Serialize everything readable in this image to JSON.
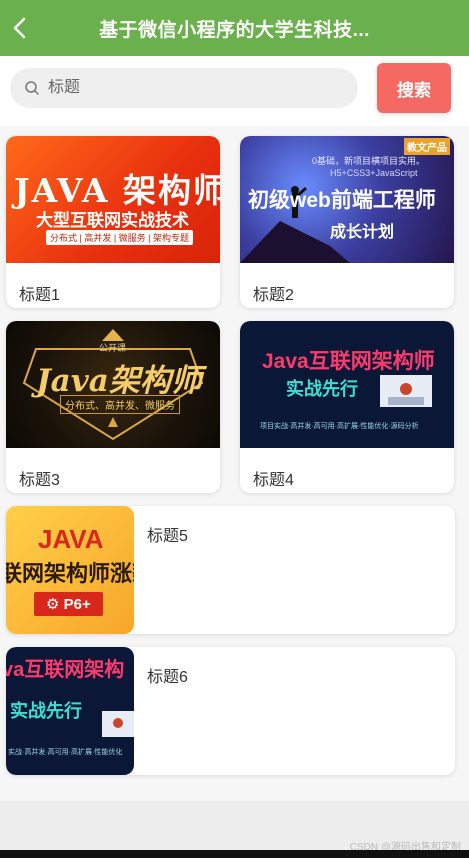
{
  "header": {
    "title": "基于微信小程序的大学生科技...",
    "back_icon": "chevron-left-icon",
    "color": "#6ab04c"
  },
  "search": {
    "placeholder": "标题",
    "button_label": "搜索",
    "button_color": "#f46a63"
  },
  "items": [
    {
      "caption": "标题1",
      "banner": {
        "line1": "JAVA 架构师",
        "line2": "大型互联网实战技术",
        "tags": "分布式 | 高并发 | 微服务 | 架构专题"
      }
    },
    {
      "caption": "标题2",
      "banner": {
        "badge": "教文产品",
        "top": "0基础，新项目横项目实用。",
        "code": "H5+CSS3+JavaScript",
        "line1": "初级web前端工程师",
        "line2": "成长计划"
      }
    },
    {
      "caption": "标题3",
      "banner": {
        "badge": "公开课",
        "line1": "Java架构师",
        "tags": "分布式、高并发、微服务"
      }
    },
    {
      "caption": "标题4",
      "banner": {
        "line1": "Java互联网架构师",
        "line2": "实战先行",
        "tags": "项目实战·高并发·高可用·高扩展·性能优化·源码分析"
      }
    },
    {
      "caption": "标题5",
      "banner": {
        "line1": "JAVA",
        "line2": "联网架构师涨薪",
        "badge": "⚙ P6+"
      }
    },
    {
      "caption": "标题6",
      "banner": {
        "line1": "va互联网架构",
        "line2": "实战先行",
        "tags": "实战·高并发·高可用·高扩展·性能优化"
      }
    }
  ],
  "watermark": "CSDN @源码出售和定制"
}
